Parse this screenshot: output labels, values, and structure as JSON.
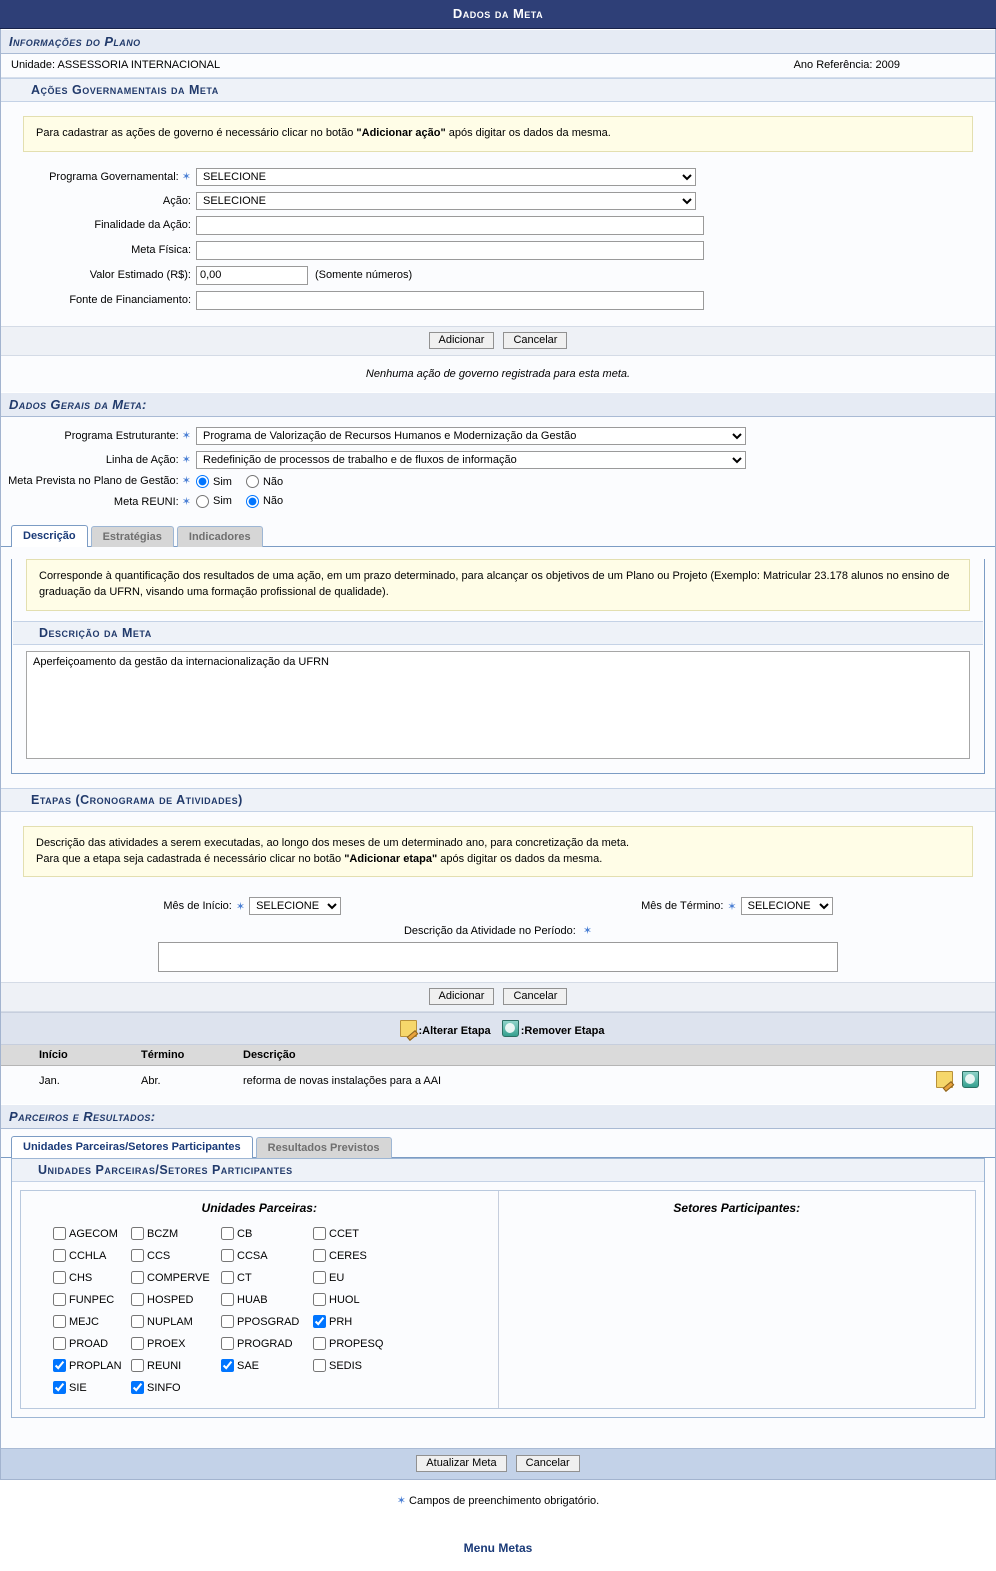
{
  "window": {
    "title": "Dados da Meta"
  },
  "plan_info": {
    "caption": "Informações do Plano",
    "unit_label": "Unidade: ASSESSORIA INTERNACIONAL",
    "year_label": "Ano Referência: 2009"
  },
  "gov_actions": {
    "caption": "Ações Governamentais da Meta",
    "note_prefix": "Para cadastrar as ações de governo é necessário clicar no botão ",
    "note_bold": "\"Adicionar ação\"",
    "note_suffix": " após digitar os dados da mesma.",
    "fields": {
      "programa_label": "Programa Governamental:",
      "programa_value": "SELECIONE",
      "acao_label": "Ação:",
      "acao_value": "SELECIONE",
      "finalidade_label": "Finalidade da Ação:",
      "finalidade_value": "",
      "meta_fisica_label": "Meta Física:",
      "meta_fisica_value": "",
      "valor_label": "Valor Estimado (R$):",
      "valor_value": "0,00",
      "valor_hint": "(Somente números)",
      "fonte_label": "Fonte de Financiamento:",
      "fonte_value": ""
    },
    "add_button": "Adicionar",
    "cancel_button": "Cancelar",
    "empty_message": "Nenhuma ação de governo registrada para esta meta."
  },
  "general_data": {
    "caption": "Dados Gerais da Meta:",
    "programa_estruturante_label": "Programa Estruturante:",
    "programa_estruturante_value": "Programa de Valorização de Recursos Humanos e Modernização da Gestão",
    "linha_acao_label": "Linha de Ação:",
    "linha_acao_value": "Redefinição de processos de trabalho e de fluxos de informação",
    "meta_prevista_label": "Meta Prevista no Plano de Gestão:",
    "meta_prevista_value": "Sim",
    "meta_reuni_label": "Meta REUNI:",
    "meta_reuni_value": "Não",
    "yes_label": "Sim",
    "no_label": "Não"
  },
  "desc_tabs": [
    {
      "label": "Descrição",
      "active": true
    },
    {
      "label": "Estratégias",
      "active": false
    },
    {
      "label": "Indicadores",
      "active": false
    }
  ],
  "description": {
    "note": "Corresponde à quantificação dos resultados de uma ação, em um prazo determinado, para alcançar os objetivos de um Plano ou Projeto (Exemplo: Matricular 23.178 alunos no ensino de graduação da UFRN, visando uma formação profissional de qualidade).",
    "caption": "Descrição da Meta",
    "value": "Aperfeiçoamento da gestão da internacionalização da UFRN"
  },
  "etapas": {
    "caption": "Etapas (Cronograma de Atividades)",
    "note_line1": "Descrição das atividades a serem executadas, ao longo dos meses de um determinado ano, para concretização da meta.",
    "note_line2_prefix": "Para que a etapa seja cadastrada é necessário clicar no botão ",
    "note_line2_bold": "\"Adicionar etapa\"",
    "note_line2_suffix": " após digitar os dados da mesma.",
    "mes_inicio_label": "Mês de Início:",
    "mes_inicio_value": "SELECIONE",
    "mes_termino_label": "Mês de Término:",
    "mes_termino_value": "SELECIONE",
    "atividade_label": "Descrição da Atividade no Período:",
    "atividade_value": "",
    "add_button": "Adicionar",
    "cancel_button": "Cancelar",
    "legend_edit": ":Alterar Etapa",
    "legend_remove": ":Remover Etapa",
    "columns": [
      "Início",
      "Término",
      "Descrição"
    ],
    "rows": [
      {
        "inicio": "Jan.",
        "termino": "Abr.",
        "descricao": "reforma de novas instalações para a AAI"
      }
    ]
  },
  "partners": {
    "caption": "Parceiros e Resultados:",
    "tabs": [
      {
        "label": "Unidades Parceiras/Setores Participantes",
        "active": true
      },
      {
        "label": "Resultados Previstos",
        "active": false
      }
    ],
    "panel_caption": "Unidades Parceiras/Setores Participantes",
    "left_title": "Unidades Parceiras:",
    "right_title": "Setores Participantes:",
    "units": [
      {
        "label": "AGECOM",
        "checked": false
      },
      {
        "label": "BCZM",
        "checked": false
      },
      {
        "label": "CB",
        "checked": false
      },
      {
        "label": "CCET",
        "checked": false
      },
      {
        "label": "CCHLA",
        "checked": false
      },
      {
        "label": "CCS",
        "checked": false
      },
      {
        "label": "CCSA",
        "checked": false
      },
      {
        "label": "CERES",
        "checked": false
      },
      {
        "label": "CHS",
        "checked": false
      },
      {
        "label": "COMPERVE",
        "checked": false
      },
      {
        "label": "CT",
        "checked": false
      },
      {
        "label": "EU",
        "checked": false
      },
      {
        "label": "FUNPEC",
        "checked": false
      },
      {
        "label": "HOSPED",
        "checked": false
      },
      {
        "label": "HUAB",
        "checked": false
      },
      {
        "label": "HUOL",
        "checked": false
      },
      {
        "label": "MEJC",
        "checked": false
      },
      {
        "label": "NUPLAM",
        "checked": false
      },
      {
        "label": "PPOSGRAD",
        "checked": false
      },
      {
        "label": "PRH",
        "checked": true
      },
      {
        "label": "PROAD",
        "checked": false
      },
      {
        "label": "PROEX",
        "checked": false
      },
      {
        "label": "PROGRAD",
        "checked": false
      },
      {
        "label": "PROPESQ",
        "checked": false
      },
      {
        "label": "PROPLAN",
        "checked": true
      },
      {
        "label": "REUNI",
        "checked": false
      },
      {
        "label": "SAE",
        "checked": true
      },
      {
        "label": "SEDIS",
        "checked": false
      },
      {
        "label": "SIE",
        "checked": true
      },
      {
        "label": "SINFO",
        "checked": true
      }
    ]
  },
  "footer": {
    "submit_button": "Atualizar Meta",
    "cancel_button": "Cancelar",
    "required_note": "Campos de preenchimento obrigatório.",
    "menu_link": "Menu Metas"
  }
}
